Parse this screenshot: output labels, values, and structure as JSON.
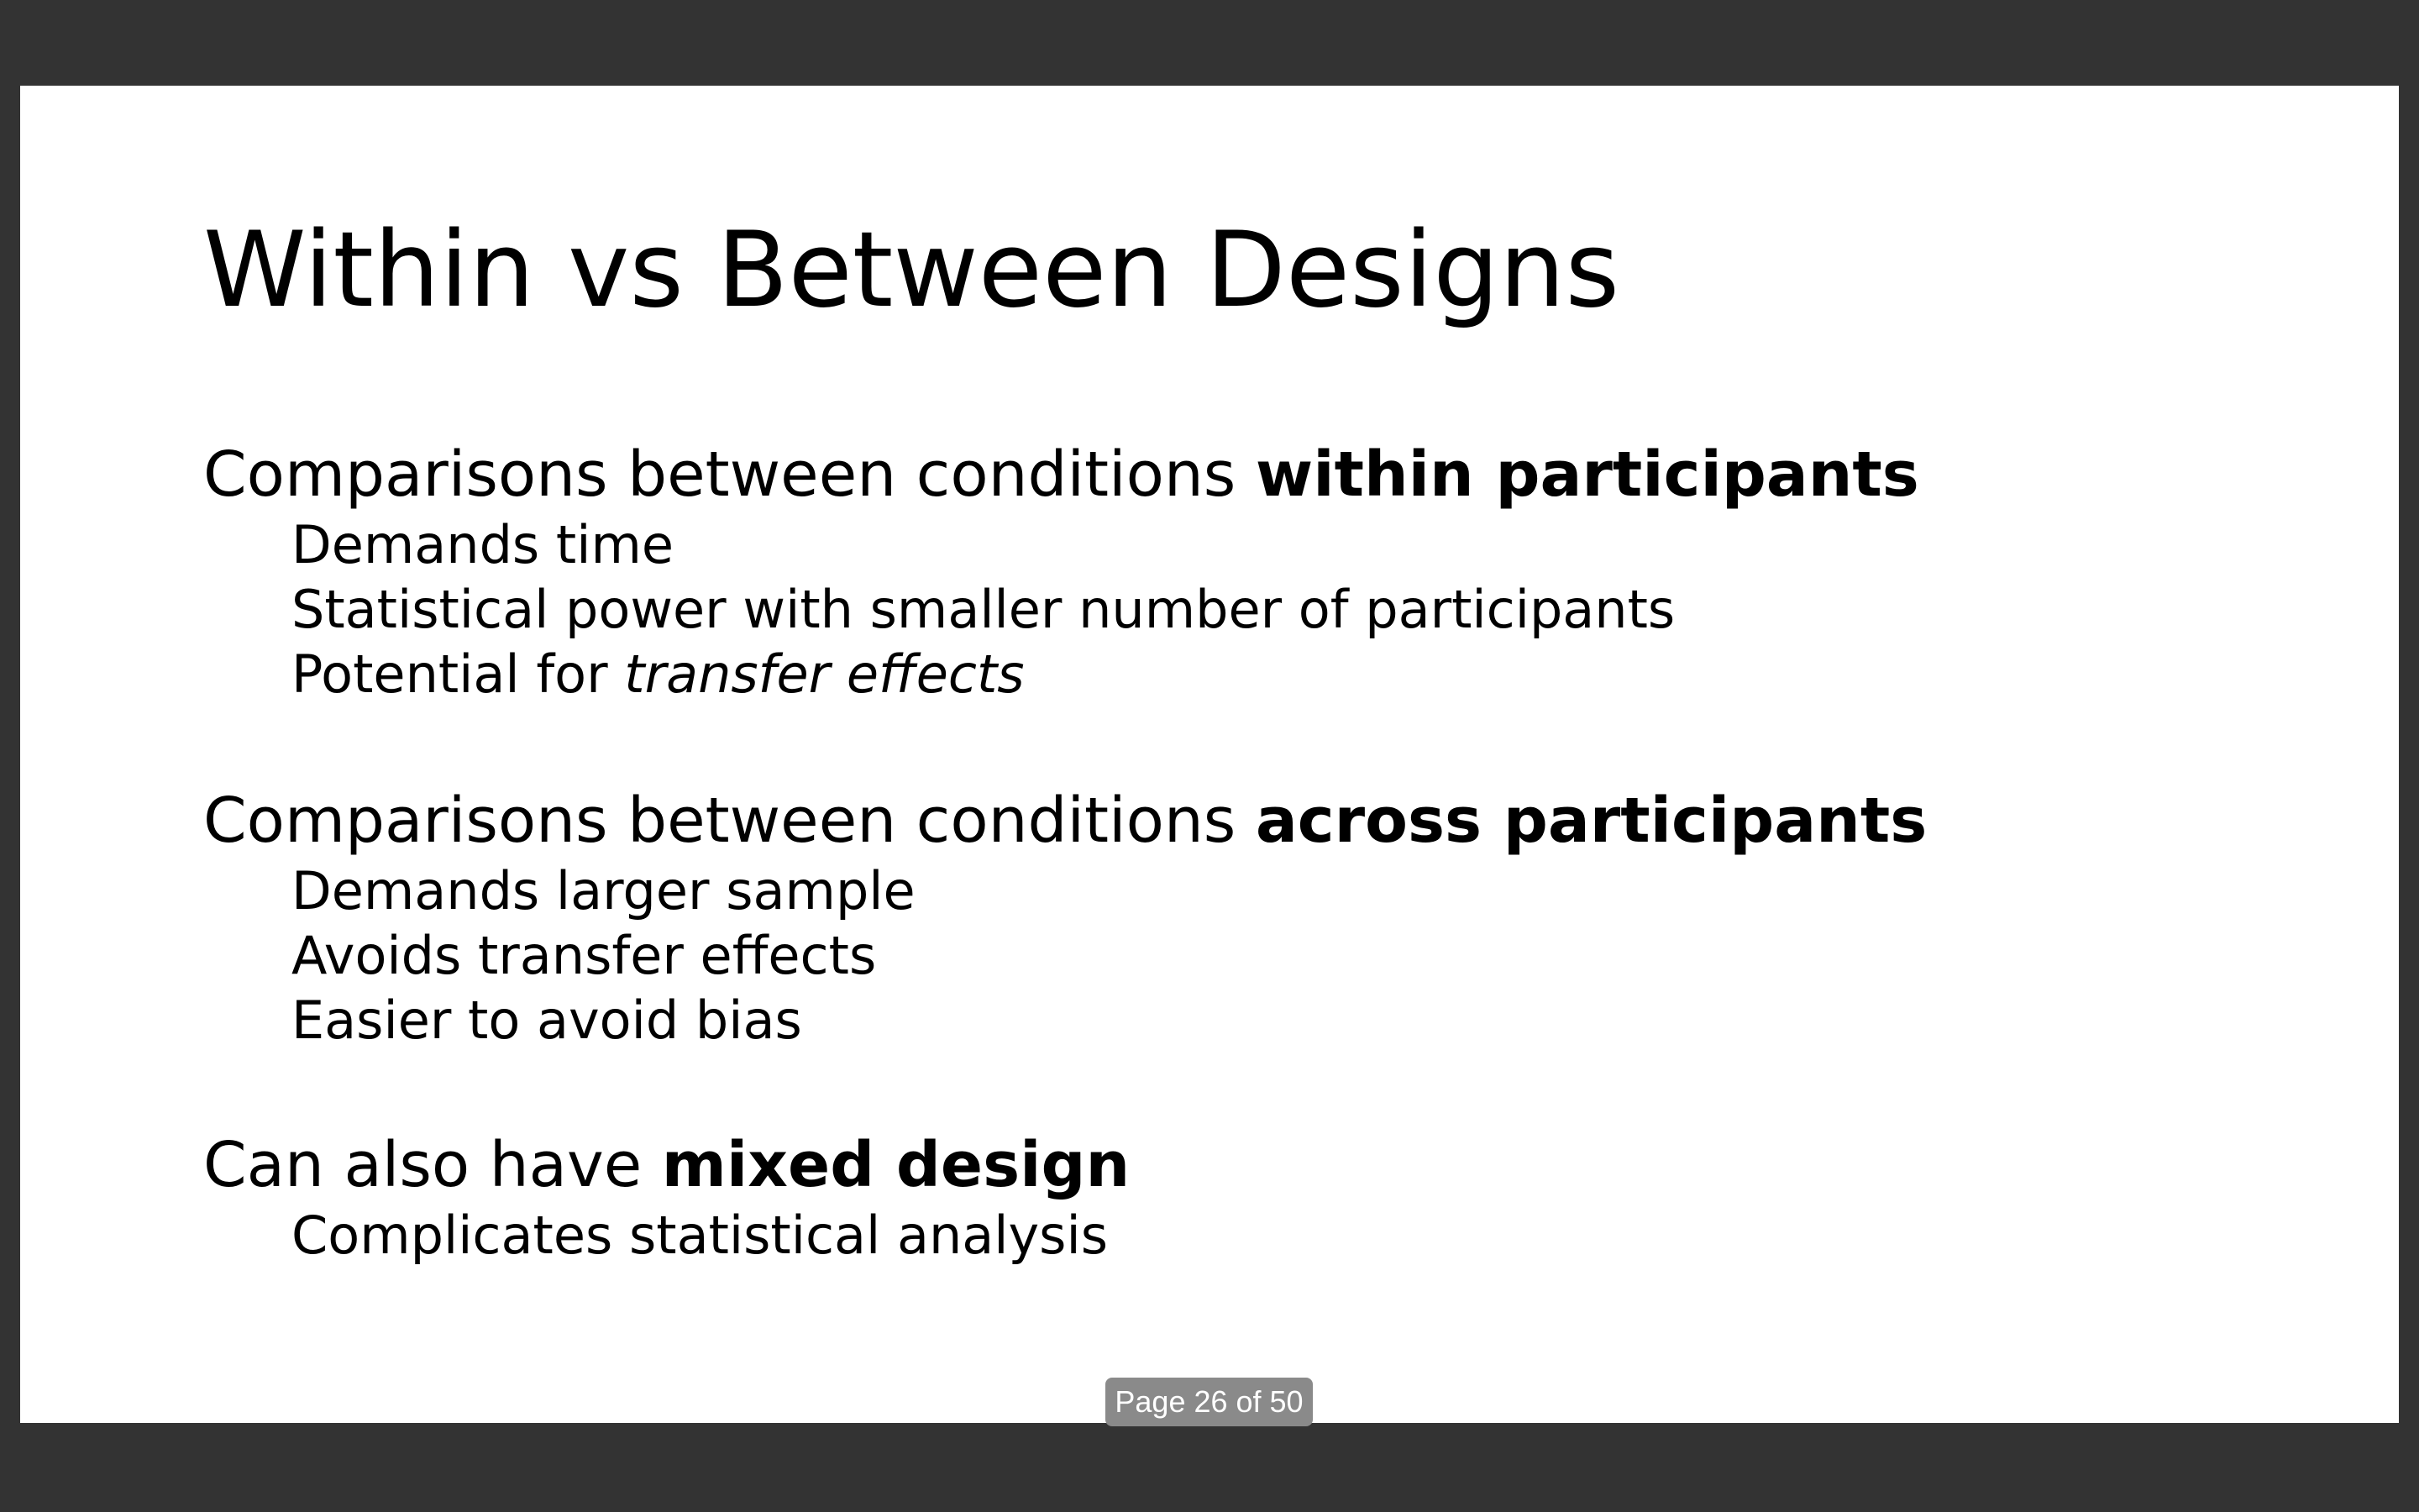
{
  "slide": {
    "title": "Within vs Between Designs",
    "sections": [
      {
        "heading_prefix": "Comparisons between conditions ",
        "heading_bold": "within participants",
        "points": [
          {
            "text": "Demands time"
          },
          {
            "text": "Statistical power with smaller number of participants"
          },
          {
            "text": "Potential for ",
            "italic": "transfer effects"
          }
        ]
      },
      {
        "heading_prefix": "Comparisons between conditions ",
        "heading_bold": "across participants",
        "points": [
          {
            "text": "Demands larger sample"
          },
          {
            "text": "Avoids transfer effects"
          },
          {
            "text": "Easier to avoid bias"
          }
        ]
      },
      {
        "heading_prefix": "Can also have ",
        "heading_bold": "mixed design",
        "points": [
          {
            "text": "Complicates statistical analysis"
          }
        ]
      }
    ]
  },
  "viewer": {
    "page_indicator": "Page 26 of 50",
    "current_page": 26,
    "total_pages": 50
  }
}
